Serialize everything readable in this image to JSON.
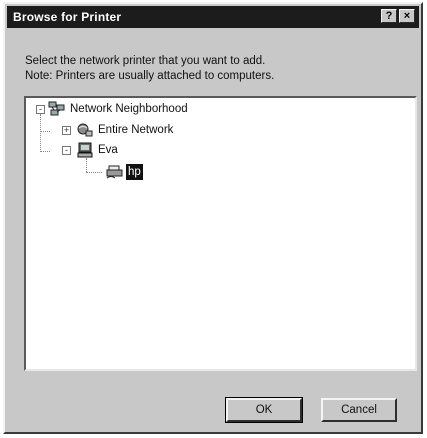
{
  "window": {
    "title": "Browse for Printer",
    "help_glyph": "?",
    "close_glyph": "×"
  },
  "instructions": {
    "line1": "Select the network printer that you want to add.",
    "line2": "Note: Printers are usually attached to computers."
  },
  "tree": {
    "items": [
      {
        "label": "Network Neighborhood",
        "icon": "network-neighborhood-icon",
        "expander": "-"
      },
      {
        "label": "Entire Network",
        "icon": "entire-network-icon",
        "expander": "+"
      },
      {
        "label": "Eva",
        "icon": "computer-icon",
        "expander": "-"
      },
      {
        "label": "hp",
        "icon": "shared-printer-icon",
        "selected": true
      }
    ]
  },
  "buttons": {
    "ok_label": "OK",
    "cancel_label": "Cancel"
  },
  "colors": {
    "titlebar": "#1c1c1c",
    "face": "#c8c8c8",
    "selection": "#111111"
  }
}
